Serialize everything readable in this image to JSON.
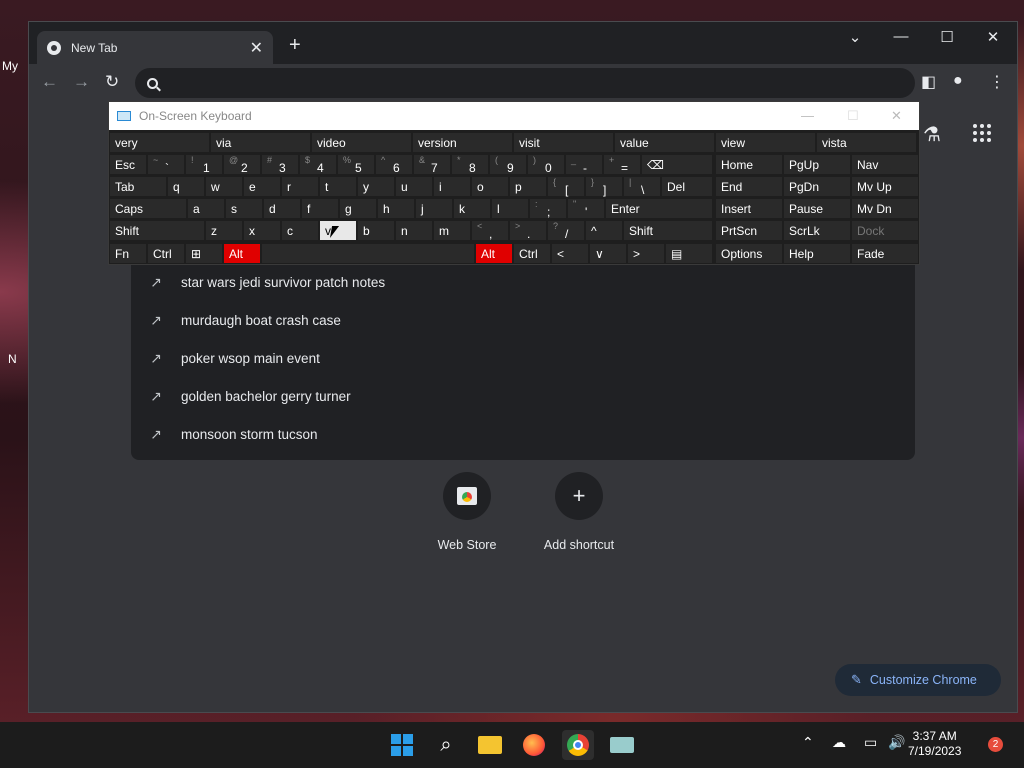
{
  "desktop": {
    "left_text_1": "My",
    "left_text_2": "N"
  },
  "tab": {
    "title": "New Tab"
  },
  "omnibox": {
    "placeholder": ""
  },
  "suggestions": [
    {
      "text": "star wars jedi survivor patch notes"
    },
    {
      "text": "murdaugh boat crash case"
    },
    {
      "text": "poker wsop main event"
    },
    {
      "text": "golden bachelor gerry turner"
    },
    {
      "text": "monsoon storm tucson"
    }
  ],
  "shortcuts": [
    {
      "label": "Web Store"
    },
    {
      "label": "Add shortcut"
    }
  ],
  "customize_label": "Customize Chrome",
  "osk": {
    "title": "On-Screen Keyboard",
    "predictions": [
      "very",
      "via",
      "video",
      "version",
      "visit",
      "value",
      "view",
      "vista"
    ],
    "nav_keys": [
      "Home",
      "PgUp",
      "Nav",
      "End",
      "PgDn",
      "Mv Up",
      "Insert",
      "Pause",
      "Mv Dn",
      "PrtScn",
      "ScrLk",
      "Dock",
      "Options",
      "Help",
      "Fade"
    ]
  },
  "taskbar": {
    "time": "3:37 AM",
    "date": "7/19/2023",
    "notifications": "2"
  },
  "colors": {
    "accent": "#8ab4f8",
    "osk_alt": "#e00000",
    "windows_blue": "#2b9ee9"
  }
}
